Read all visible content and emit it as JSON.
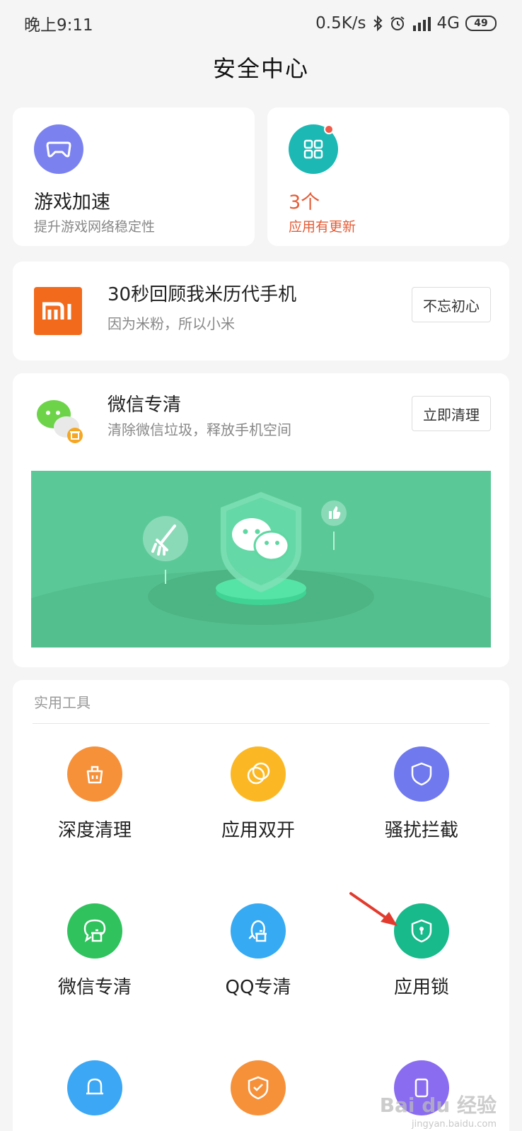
{
  "status_bar": {
    "time": "晚上9:11",
    "speed": "0.5K/s",
    "network": "4G",
    "battery": "49"
  },
  "page_title": "安全中心",
  "game_card": {
    "title": "游戏加速",
    "subtitle": "提升游戏网络稳定性",
    "icon": "gamepad-icon",
    "icon_color": "#7b82f0"
  },
  "update_card": {
    "count": "3个",
    "subtitle": "应用有更新",
    "icon": "apps-grid-icon",
    "icon_color": "#1bb8b4",
    "accent": "#e55c36"
  },
  "mi_card": {
    "title": "30秒回顾我米历代手机",
    "subtitle": "因为米粉，所以小米",
    "button": "不忘初心",
    "logo_text": "mi",
    "logo_color": "#f26b1d"
  },
  "wechat_card": {
    "title": "微信专清",
    "subtitle": "清除微信垃圾，释放手机空间",
    "button": "立即清理",
    "banner_color": "#5bc997"
  },
  "tools": {
    "header": "实用工具",
    "items": [
      {
        "label": "深度清理",
        "icon": "deep-clean-icon",
        "color": "#f6913a"
      },
      {
        "label": "应用双开",
        "icon": "dual-apps-icon",
        "color": "#fbb824"
      },
      {
        "label": "骚扰拦截",
        "icon": "shield-icon",
        "color": "#7079ee"
      },
      {
        "label": "微信专清",
        "icon": "wechat-clean-icon",
        "color": "#2fc25d"
      },
      {
        "label": "QQ专清",
        "icon": "qq-clean-icon",
        "color": "#36aaf3"
      },
      {
        "label": "应用锁",
        "icon": "app-lock-icon",
        "color": "#18b98a"
      }
    ]
  },
  "watermark": {
    "text": "Bai du 经验",
    "sub": "jingyan.baidu.com"
  }
}
